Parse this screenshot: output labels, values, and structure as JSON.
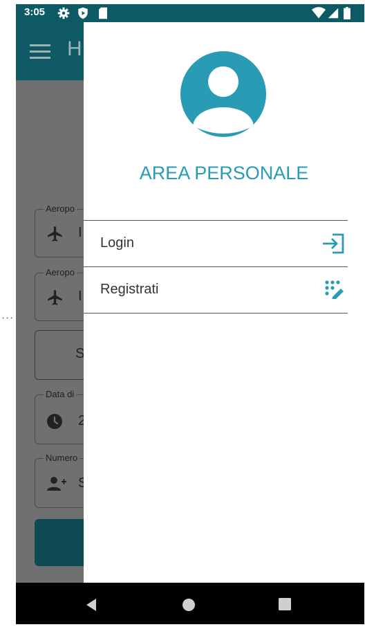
{
  "status_bar": {
    "time": "3:05",
    "icons": [
      "settings-icon",
      "shield-icon",
      "sd-card-icon",
      "wifi-icon",
      "signal-icon",
      "battery-icon"
    ]
  },
  "app_bar": {
    "title": "H",
    "menu_icon": "hamburger-icon"
  },
  "form": {
    "field1": {
      "label": "Aeropo",
      "icon": "airplane-icon",
      "value": "I"
    },
    "field2": {
      "label": "Aeropo",
      "icon": "airplane-icon",
      "value": "I"
    },
    "outlined_button": {
      "label": "S"
    },
    "date_field": {
      "label": "Data di",
      "icon": "clock-icon",
      "value": "2"
    },
    "passengers_field": {
      "label": "Numero",
      "icon": "add-person-icon",
      "value": "S"
    }
  },
  "drawer": {
    "avatar_icon": "account-circle-icon",
    "title": "AREA PERSONALE",
    "items": [
      {
        "label": "Login",
        "icon": "login-icon"
      },
      {
        "label": "Registrati",
        "icon": "register-icon"
      }
    ]
  },
  "nav_bar": {
    "icons": [
      "back-icon",
      "home-icon",
      "recents-icon"
    ]
  },
  "colors": {
    "accent": "#2a9bb5",
    "app_bar": "#0e5963",
    "status_bar": "#0e5a64",
    "scrim_background": "#707070"
  }
}
